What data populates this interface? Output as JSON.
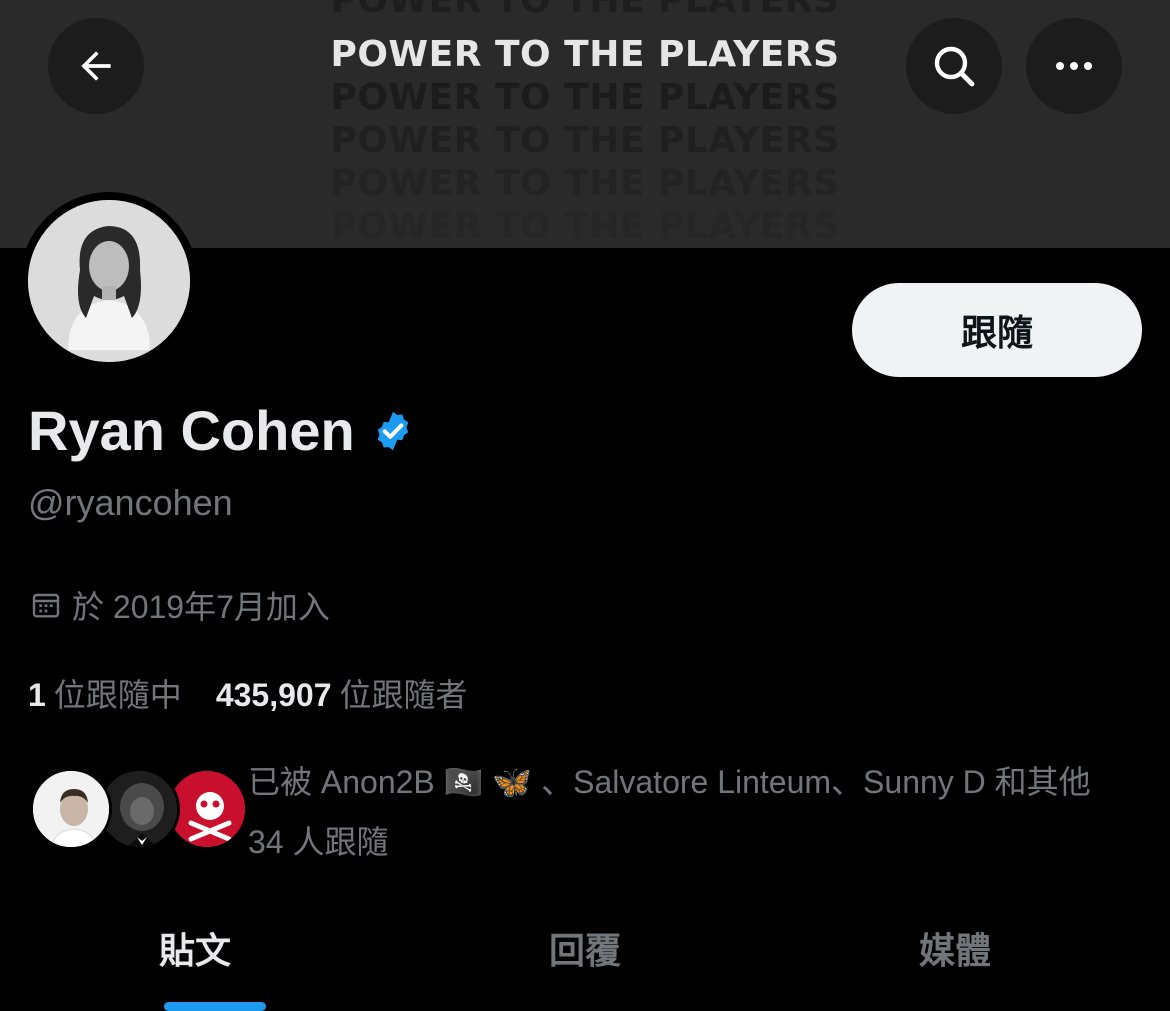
{
  "banner": {
    "text": "POWER TO THE PLAYERS"
  },
  "header": {
    "back_icon": "arrow-left-icon",
    "search_icon": "search-icon",
    "more_icon": "more-horizontal-icon"
  },
  "profile": {
    "name": "Ryan Cohen",
    "verified": true,
    "handle": "@ryancohen",
    "joined": "於 2019年7月加入",
    "follow_label": "跟隨",
    "following_count": "1",
    "following_label": "位跟隨中",
    "followers_count": "435,907",
    "followers_label": "位跟隨者"
  },
  "followers_you_know": {
    "line1": "已被 Anon2B 🏴‍☠️ 🦋 、Salvatore Linteum、Sunny D 和其他",
    "line2": "34 人跟隨"
  },
  "tabs": [
    {
      "label": "貼文",
      "active": true
    },
    {
      "label": "回覆",
      "active": false
    },
    {
      "label": "媒體",
      "active": false
    }
  ],
  "colors": {
    "accent": "#1d9bf0",
    "background": "#000000",
    "secondary_text": "#71767b"
  }
}
